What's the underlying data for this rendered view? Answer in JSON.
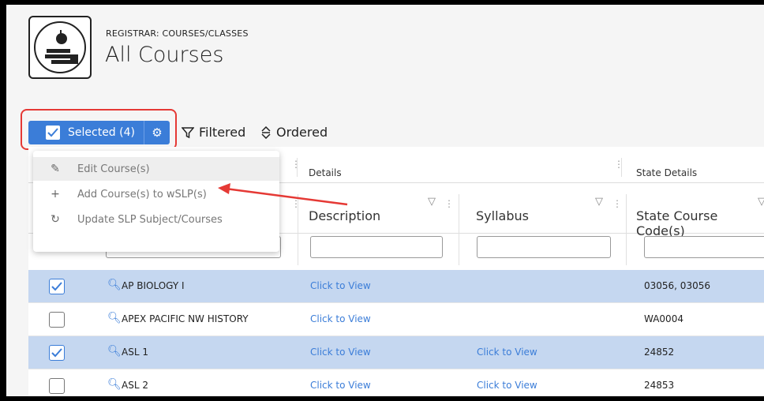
{
  "header": {
    "breadcrumb": "REGISTRAR: COURSES/CLASSES",
    "title": "All Courses",
    "logo_icon": "school-apple-books-icon"
  },
  "toolbar": {
    "selected_label": "Selected (4)",
    "filtered_label": "Filtered",
    "ordered_label": "Ordered",
    "accent": "#3b7dd8",
    "highlight_box_color": "#e53935"
  },
  "menu": {
    "items": [
      {
        "icon": "edit-icon",
        "label": "Edit Course(s)"
      },
      {
        "icon": "plus-icon",
        "label": "Add Course(s) to wSLP(s)"
      },
      {
        "icon": "refresh-icon",
        "label": "Update SLP Subject/Courses"
      }
    ]
  },
  "grid": {
    "groups": [
      "Details",
      "State Details"
    ],
    "columns": [
      "Description",
      "Syllabus",
      "State Course Code(s)"
    ],
    "rows": [
      {
        "selected": true,
        "name": "AP BIOLOGY I",
        "description": "Click to View",
        "syllabus": "",
        "state_code": "03056, 03056"
      },
      {
        "selected": false,
        "name": "APEX PACIFIC NW HISTORY",
        "description": "Click to View",
        "syllabus": "",
        "state_code": "WA0004"
      },
      {
        "selected": true,
        "name": "ASL 1",
        "description": "Click to View",
        "syllabus": "Click to View",
        "state_code": "24852"
      },
      {
        "selected": false,
        "name": "ASL 2",
        "description": "Click to View",
        "syllabus": "Click to View",
        "state_code": "24853"
      }
    ]
  }
}
